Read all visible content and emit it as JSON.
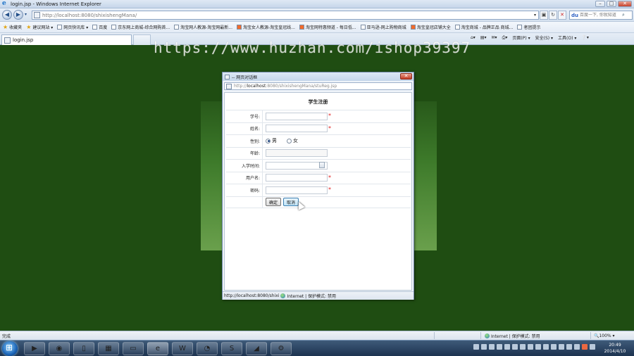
{
  "window": {
    "title": "login.jsp - Windows Internet Explorer",
    "minimize": "–",
    "maximize": "□",
    "close": "✕"
  },
  "address_bar": {
    "url": "http://localhost:8080/shixishengMana/",
    "search_placeholder": "百度一下, 你就知道"
  },
  "favorites_bar": {
    "favorites_label": "收藏夹",
    "items": [
      "建议网站 ▾",
      "网页快讯库 ▾",
      "百度",
      "京东网上商城-综合网购首...",
      "淘宝网人教源-淘宝网最新...",
      "淘宝女人教源-淘宝皇冠线...",
      "淘宝网特惠频道 - 每日低...",
      "亚马逊-网上购物商城",
      "淘宝皇冠店铺大全",
      "淘宝商城 - 品牌正品 商城...",
      "者团提示"
    ]
  },
  "tab": {
    "label": "login.jsp"
  },
  "command_bar": {
    "page": "页面(P) ▾",
    "safety": "安全(S) ▾",
    "tools": "工具(O) ▾",
    "help": "❔▾"
  },
  "watermark": "https://www.huzhan.com/ishop39397",
  "popup": {
    "title": "-- 网页对话框",
    "close": "✕",
    "url_prefix": "http://",
    "url_host": "localhost",
    "url_rest": ":8080/shixishengMana/stuReg.jsp",
    "form_title": "学生注册",
    "fields": {
      "student_no": "学号:",
      "name": "姓名:",
      "gender": "性别:",
      "age": "年龄:",
      "enroll_time": "入学时间:",
      "username": "用户名:",
      "password": "密码:"
    },
    "required_mark": "*",
    "gender_options": [
      "男",
      "女"
    ],
    "buttons": {
      "confirm": "确定",
      "cancel": "取消"
    },
    "status_url": "http://localhost:8080/shixi",
    "status_zone": "Internet | 保护模式: 禁用"
  },
  "status_bar": {
    "left": "完成",
    "zone": "Internet | 保护模式: 禁用",
    "zoom": "🔍100%  ▾"
  },
  "clock": {
    "time": "20:49",
    "date": "2014/4/10"
  }
}
